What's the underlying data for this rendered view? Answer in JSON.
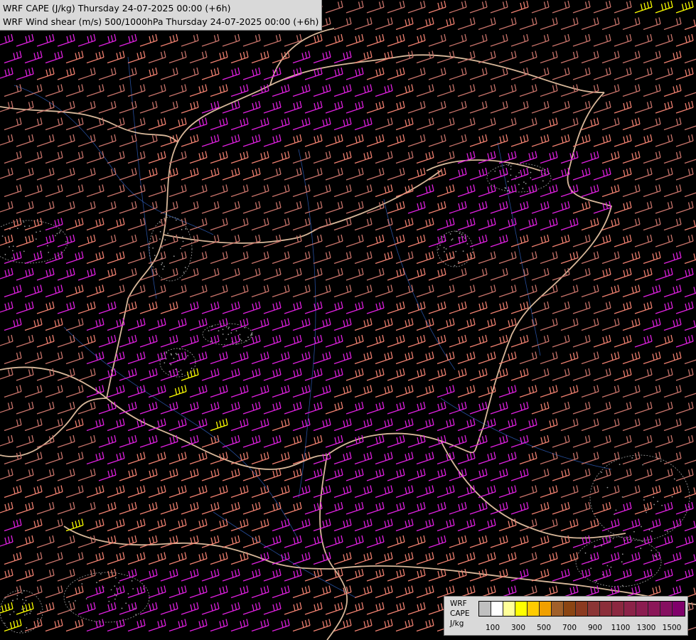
{
  "titles": {
    "line1": "WRF CAPE (J/kg) Thursday 24-07-2025 00:00 (+6h)",
    "line2": "WRF Wind shear (m/s) 500/1000hPa Thursday 24-07-2025 00:00 (+6h)"
  },
  "legend": {
    "label1": "WRF",
    "label2": "CAPE",
    "label3": "J/kg",
    "colors": [
      "#c0c0c0",
      "#ffffff",
      "#ffff99",
      "#ffff00",
      "#ffcc00",
      "#f0a000",
      "#a0602a",
      "#8b4513",
      "#8b3a20",
      "#8b3535",
      "#8b2e3a",
      "#8b2840",
      "#8b2248",
      "#8b1c50",
      "#8b1658",
      "#850f60",
      "#80006a"
    ],
    "ticks": [
      "100",
      "300",
      "500",
      "700",
      "900",
      "1100",
      "1300",
      "1500"
    ]
  },
  "barb_colors": {
    "weak": "#c8736a",
    "medium": "#f08070",
    "strong": "#e020e0",
    "extreme": "#ffff00"
  },
  "map_colors": {
    "borders": "#d8b89a",
    "rivers": "#3060c0",
    "cape_contours": "#a0a0a0"
  }
}
